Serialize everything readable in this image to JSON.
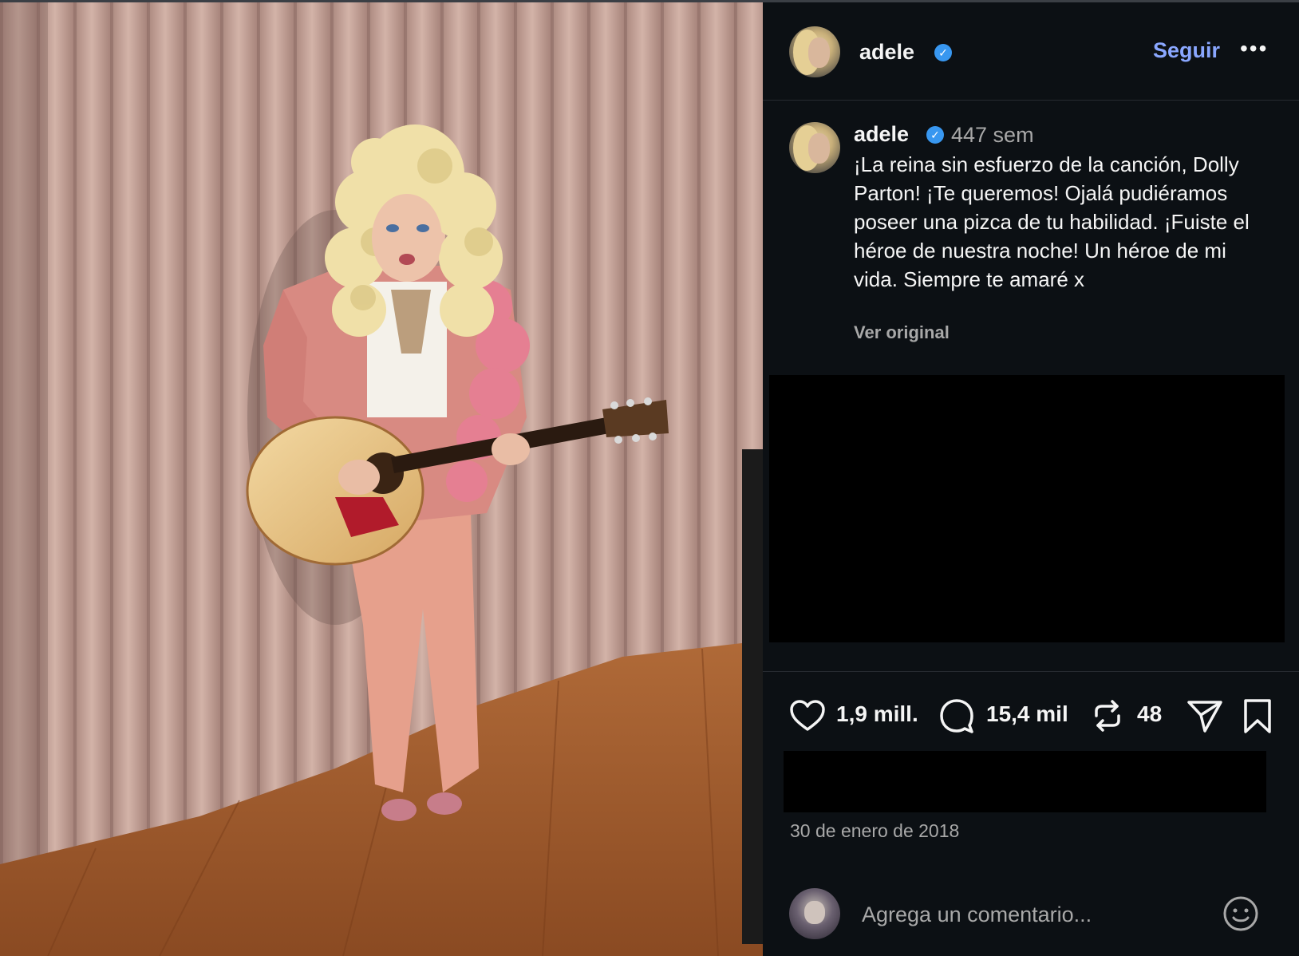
{
  "post": {
    "username": "adele",
    "follow_label": "Seguir",
    "more_label": "•••",
    "verified_mark": "✓"
  },
  "caption": {
    "username": "adele",
    "time_ago": "447 sem",
    "text": "¡La reina sin esfuerzo de la canción, Dolly Parton! ¡Te queremos! Ojalá pudiéramos poseer una pizca de tu habilidad. ¡Fuiste el héroe de nuestra noche! Un héroe de mi vida. Siempre te amaré x",
    "see_original": "Ver original"
  },
  "actions": {
    "likes": "1,9 mill.",
    "comments": "15,4 mil",
    "reposts": "48"
  },
  "date": "30 de enero de 2018",
  "comment_box": {
    "placeholder": "Agrega un comentario..."
  },
  "icons": {
    "like": "heart-icon",
    "comment": "comment-bubble-icon",
    "repost": "repost-icon",
    "share": "send-icon",
    "save": "bookmark-icon",
    "emoji": "emoji-icon",
    "verified": "verified-badge-icon",
    "more": "more-options-icon"
  },
  "colors": {
    "background": "#0c1014",
    "text": "#f5f5f5",
    "muted": "#a8a8a8",
    "follow": "#8aa7ff",
    "verified": "#3897f0"
  }
}
